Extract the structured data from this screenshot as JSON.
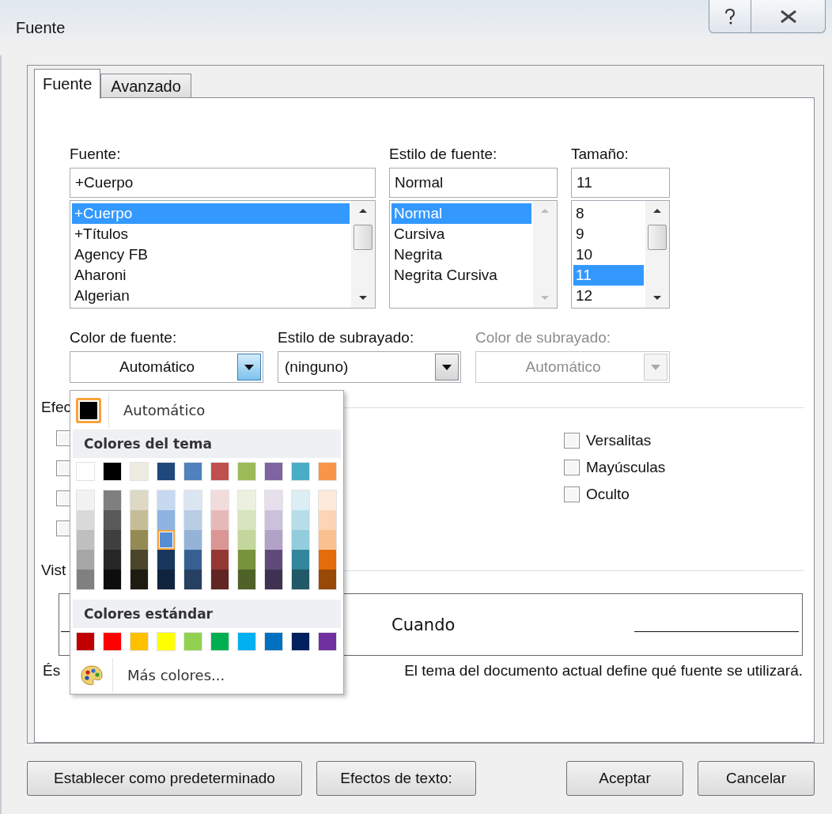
{
  "window": {
    "title": "Fuente"
  },
  "tabs": [
    {
      "label": "Fuente",
      "selected": true
    },
    {
      "label": "Avanzado",
      "selected": false
    }
  ],
  "font_lists": [
    {
      "label": "Fuente:",
      "value": "+Cuerpo",
      "items": [
        {
          "label": "+Cuerpo",
          "selected": true
        },
        {
          "label": "+Títulos",
          "selected": false
        },
        {
          "label": "Agency FB",
          "selected": false
        },
        {
          "label": "Aharoni",
          "selected": false
        },
        {
          "label": "Algerian",
          "selected": false
        }
      ]
    },
    {
      "label": "Estilo de fuente:",
      "value": "Normal",
      "items": [
        {
          "label": "Normal",
          "selected": true
        },
        {
          "label": "Cursiva",
          "selected": false
        },
        {
          "label": "Negrita",
          "selected": false
        },
        {
          "label": "Negrita Cursiva",
          "selected": false
        }
      ]
    },
    {
      "label": "Tamaño:",
      "value": "11",
      "items": [
        {
          "label": "8",
          "selected": false
        },
        {
          "label": "9",
          "selected": false
        },
        {
          "label": "10",
          "selected": false
        },
        {
          "label": "11",
          "selected": true
        },
        {
          "label": "12",
          "selected": false
        }
      ]
    }
  ],
  "dropdowns": [
    {
      "label": "Color de fuente:",
      "value": "Automático",
      "disabled": false,
      "open": true
    },
    {
      "label": "Estilo de subrayado:",
      "value": "(ninguno)",
      "disabled": false,
      "open": false
    },
    {
      "label": "Color de subrayado:",
      "value": "Automático",
      "disabled": true,
      "open": false
    }
  ],
  "effects": {
    "heading": "Efec",
    "left_column": [
      {
        "checked": false
      },
      {
        "checked": false
      },
      {
        "checked": false
      },
      {
        "checked": false
      }
    ],
    "right_column": [
      {
        "label": "Versalitas",
        "checked": false
      },
      {
        "label": "Mayúsculas",
        "checked": false
      },
      {
        "label": "Oculto",
        "checked": false
      }
    ]
  },
  "preview": {
    "heading": "Vist",
    "sample": "Cuando",
    "note_start": "És",
    "note_end": "El tema del documento actual define qué fuente se utilizará."
  },
  "color_menu": {
    "automatic": {
      "label": "Automático",
      "color": "#000000"
    },
    "theme_heading": "Colores del tema",
    "theme_columns": [
      {
        "color": "#ffffff",
        "shades": [
          {
            "color": "#f2f2f2",
            "selected": false
          },
          {
            "color": "#d9d9d9",
            "selected": false
          },
          {
            "color": "#bfbfbf",
            "selected": false
          },
          {
            "color": "#a6a6a6",
            "selected": false
          },
          {
            "color": "#808080",
            "selected": false
          }
        ]
      },
      {
        "color": "#000000",
        "shades": [
          {
            "color": "#7f7f7f",
            "selected": false
          },
          {
            "color": "#595959",
            "selected": false
          },
          {
            "color": "#3f3f3f",
            "selected": false
          },
          {
            "color": "#262626",
            "selected": false
          },
          {
            "color": "#0d0d0d",
            "selected": false
          }
        ]
      },
      {
        "color": "#eeece1",
        "shades": [
          {
            "color": "#ddd9c4",
            "selected": false
          },
          {
            "color": "#c4bd97",
            "selected": false
          },
          {
            "color": "#948a54",
            "selected": false
          },
          {
            "color": "#4a452a",
            "selected": false
          },
          {
            "color": "#1e1c11",
            "selected": false
          }
        ]
      },
      {
        "color": "#1f497d",
        "shades": [
          {
            "color": "#c6d9f1",
            "selected": false
          },
          {
            "color": "#8db4e3",
            "selected": false
          },
          {
            "color": "#558ed5",
            "selected": true
          },
          {
            "color": "#17375e",
            "selected": false
          },
          {
            "color": "#10243f",
            "selected": false
          }
        ]
      },
      {
        "color": "#4f81bd",
        "shades": [
          {
            "color": "#dce6f2",
            "selected": false
          },
          {
            "color": "#b9cde5",
            "selected": false
          },
          {
            "color": "#95b3d7",
            "selected": false
          },
          {
            "color": "#376092",
            "selected": false
          },
          {
            "color": "#254061",
            "selected": false
          }
        ]
      },
      {
        "color": "#c0504d",
        "shades": [
          {
            "color": "#f2dcdb",
            "selected": false
          },
          {
            "color": "#e6b9b8",
            "selected": false
          },
          {
            "color": "#d99694",
            "selected": false
          },
          {
            "color": "#953735",
            "selected": false
          },
          {
            "color": "#632523",
            "selected": false
          }
        ]
      },
      {
        "color": "#9bbb59",
        "shades": [
          {
            "color": "#ebf1de",
            "selected": false
          },
          {
            "color": "#d7e4bd",
            "selected": false
          },
          {
            "color": "#c3d69b",
            "selected": false
          },
          {
            "color": "#77933c",
            "selected": false
          },
          {
            "color": "#4f6228",
            "selected": false
          }
        ]
      },
      {
        "color": "#8064a2",
        "shades": [
          {
            "color": "#e6e0ec",
            "selected": false
          },
          {
            "color": "#ccc1da",
            "selected": false
          },
          {
            "color": "#b3a2c7",
            "selected": false
          },
          {
            "color": "#604a7b",
            "selected": false
          },
          {
            "color": "#403152",
            "selected": false
          }
        ]
      },
      {
        "color": "#4bacc6",
        "shades": [
          {
            "color": "#dbeef4",
            "selected": false
          },
          {
            "color": "#b7dee8",
            "selected": false
          },
          {
            "color": "#93cddd",
            "selected": false
          },
          {
            "color": "#31859c",
            "selected": false
          },
          {
            "color": "#215968",
            "selected": false
          }
        ]
      },
      {
        "color": "#f79646",
        "shades": [
          {
            "color": "#fdeada",
            "selected": false
          },
          {
            "color": "#fcd5b5",
            "selected": false
          },
          {
            "color": "#fac090",
            "selected": false
          },
          {
            "color": "#e46c0a",
            "selected": false
          },
          {
            "color": "#984807",
            "selected": false
          }
        ]
      }
    ],
    "standard_heading": "Colores estándar",
    "standard_colors": [
      {
        "color": "#c00000"
      },
      {
        "color": "#ff0000"
      },
      {
        "color": "#ffc000"
      },
      {
        "color": "#ffff00"
      },
      {
        "color": "#92d050"
      },
      {
        "color": "#00b050"
      },
      {
        "color": "#00b0f0"
      },
      {
        "color": "#0070c0"
      },
      {
        "color": "#002060"
      },
      {
        "color": "#7030a0"
      }
    ],
    "more": "Más colores..."
  },
  "buttons_left": [
    {
      "label": "Establecer como predeterminado"
    },
    {
      "label": "Efectos de texto:"
    }
  ],
  "buttons_right": [
    {
      "label": "Aceptar"
    },
    {
      "label": "Cancelar"
    }
  ]
}
